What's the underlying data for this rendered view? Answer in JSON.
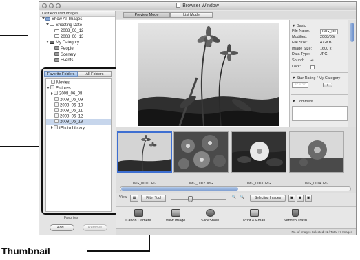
{
  "callout": {
    "label": "Thumbnail"
  },
  "window": {
    "title": "Browser Window"
  },
  "left_panel": {
    "header": "Last Acquired Images",
    "tree": [
      {
        "label": "Show All Images",
        "icon": "folder-icon"
      },
      {
        "label": "Shooting Date",
        "icon": "calendar-icon"
      },
      {
        "label": "2008_06_12",
        "icon": "calendar-day-icon"
      },
      {
        "label": "2008_06_13",
        "icon": "calendar-day-icon"
      },
      {
        "label": "My Category",
        "icon": "category-icon"
      },
      {
        "label": "People",
        "icon": "people-icon"
      },
      {
        "label": "Scenery",
        "icon": "scenery-icon"
      },
      {
        "label": "Events",
        "icon": "events-icon"
      }
    ],
    "tabs": {
      "favorite": "Favorite Folders",
      "all": "All Folders"
    },
    "folders": [
      {
        "label": "Movies",
        "indent": 0
      },
      {
        "label": "Pictures",
        "indent": 0
      },
      {
        "label": "2008_06_08",
        "indent": 1
      },
      {
        "label": "2008_06_09",
        "indent": 1
      },
      {
        "label": "2008_06_10",
        "indent": 1
      },
      {
        "label": "2008_06_11",
        "indent": 1
      },
      {
        "label": "2008_06_12",
        "indent": 1
      },
      {
        "label": "2008_06_13",
        "indent": 1
      },
      {
        "label": "iPhoto Library",
        "indent": 1
      }
    ],
    "favorites": {
      "label": "Favorites",
      "add": "Add...",
      "remove": "Remove"
    }
  },
  "modes": {
    "preview": "Preview Mode",
    "list": "List Mode"
  },
  "info": {
    "basic_header": "▼ Basic",
    "rows": [
      {
        "label": "File Name:",
        "value": "IMG_00"
      },
      {
        "label": "Modified:",
        "value": "2008/06/"
      },
      {
        "label": "File Size:",
        "value": "472KB"
      },
      {
        "label": "Image Size:",
        "value": "1600 x"
      },
      {
        "label": "Data Type:",
        "value": "JPG"
      },
      {
        "label": "Sound:",
        "value": ""
      },
      {
        "label": "Lock:",
        "value": ""
      }
    ],
    "star_header": "▼ Star Rating / My Category",
    "stars": "☆☆☆",
    "comment_header": "▼ Comment"
  },
  "thumbnails": [
    {
      "label": "IMG_0001.JPG"
    },
    {
      "label": "IMG_0002.JPG"
    },
    {
      "label": "IMG_0003.JPG"
    },
    {
      "label": "IMG_0004.JPG"
    }
  ],
  "viewbar": {
    "label": "View",
    "filter": "Filter Tool",
    "selecting": "Selecting Images"
  },
  "actions": [
    {
      "label": "Canon Camera"
    },
    {
      "label": "View Image"
    },
    {
      "label": "SlideShow"
    },
    {
      "label": "Print & Email"
    },
    {
      "label": "Send to Trash"
    }
  ],
  "status": "No. of Images Selected : 1 / Total : 7 Images"
}
